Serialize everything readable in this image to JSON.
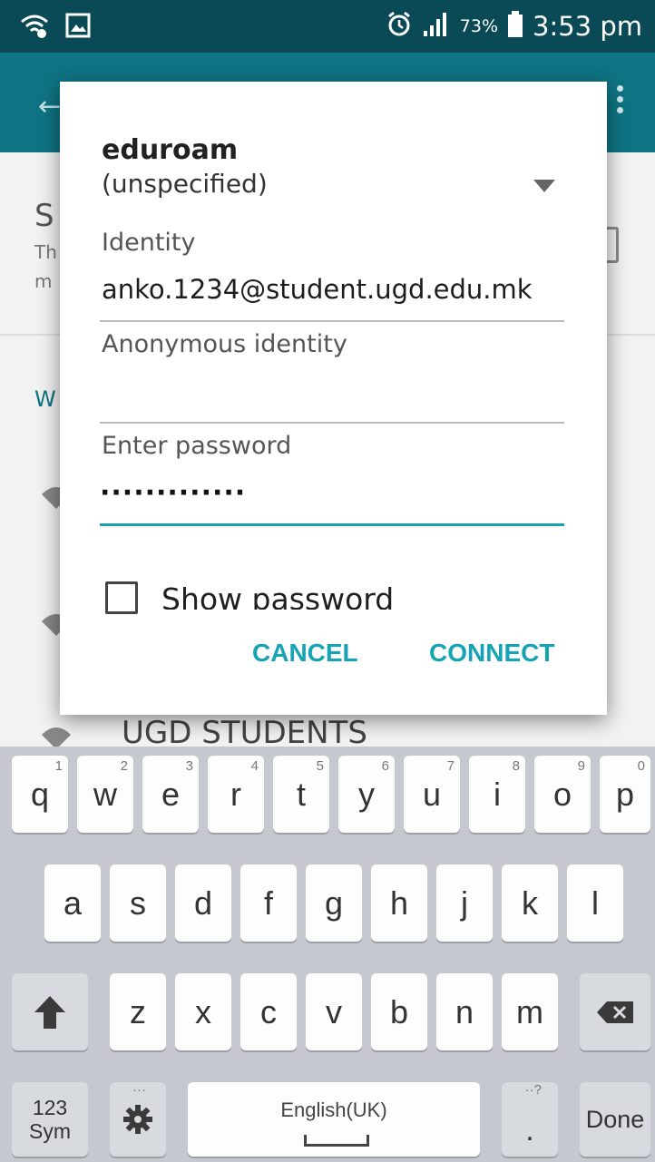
{
  "status_bar": {
    "battery_percent": "73%",
    "time": "3:53 pm",
    "icons": [
      "wifi-calling-icon",
      "image-notification-icon",
      "alarm-clock-icon",
      "signal-icon",
      "battery-icon"
    ]
  },
  "background": {
    "section_letter": "S",
    "line1_letters": "Th",
    "line2_letters": "m",
    "wifi_letter": "W",
    "network_name": "UGD STUDENTS"
  },
  "dialog": {
    "ssid": "eduroam",
    "eap_method": "(unspecified)",
    "identity_label": "Identity",
    "identity_value": "anko.1234@student.ugd.edu.mk",
    "anonymous_label": "Anonymous identity",
    "anonymous_value": "",
    "password_label": "Enter password",
    "password_masked": "·············",
    "show_password_label": "Show password",
    "cancel_label": "CANCEL",
    "connect_label": "CONNECT",
    "accent_color": "#15a3b5"
  },
  "keyboard": {
    "row1": [
      {
        "key": "q",
        "num": "1"
      },
      {
        "key": "w",
        "num": "2"
      },
      {
        "key": "e",
        "num": "3"
      },
      {
        "key": "r",
        "num": "4"
      },
      {
        "key": "t",
        "num": "5"
      },
      {
        "key": "y",
        "num": "6"
      },
      {
        "key": "u",
        "num": "7"
      },
      {
        "key": "i",
        "num": "8"
      },
      {
        "key": "o",
        "num": "9"
      },
      {
        "key": "p",
        "num": "0"
      }
    ],
    "row2": [
      "a",
      "s",
      "d",
      "f",
      "g",
      "h",
      "j",
      "k",
      "l"
    ],
    "row3": [
      "z",
      "x",
      "c",
      "v",
      "b",
      "n",
      "m"
    ],
    "sym_line1": "123",
    "sym_line2": "Sym",
    "settings_hint": "···",
    "space_label": "English(UK)",
    "period_key": ".",
    "period_hint": "··?",
    "done_label": "Done"
  }
}
